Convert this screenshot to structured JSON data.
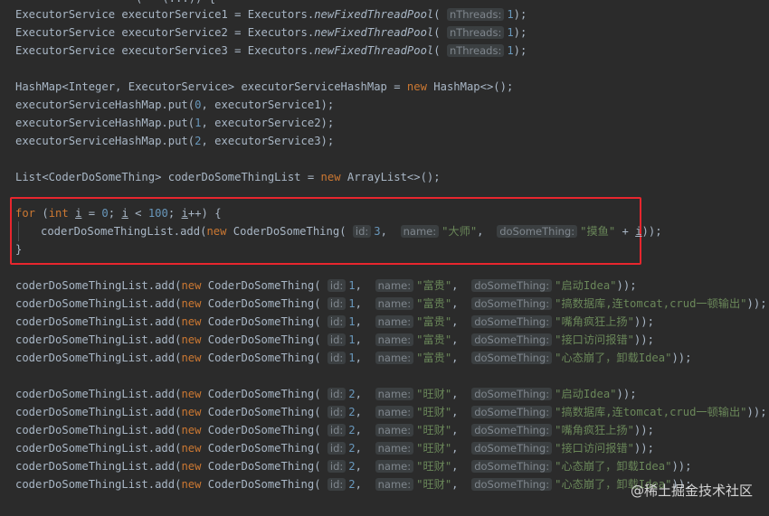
{
  "top_partial": "(   (...)) {",
  "executors": [
    {
      "var": "executorService1",
      "hint": "nThreads:",
      "val": "1"
    },
    {
      "var": "executorService2",
      "hint": "nThreads:",
      "val": "1"
    },
    {
      "var": "executorService3",
      "hint": "nThreads:",
      "val": "1"
    }
  ],
  "hashmap_decl": "HashMap<Integer, ExecutorService> executorServiceHashMap = ",
  "new_kw": "new",
  "hashmap_ctor": " HashMap<>();",
  "puts": [
    {
      "idx": "0",
      "var": "executorService1"
    },
    {
      "idx": "1",
      "var": "executorService2"
    },
    {
      "idx": "2",
      "var": "executorService3"
    }
  ],
  "list_decl": "List<CoderDoSomeThing> coderDoSomeThingList = ",
  "list_ctor": " ArrayList<>();",
  "for_loop": {
    "kw_for": "for",
    "kw_int": "int",
    "limit": "100",
    "body_id": "3",
    "body_name": "\"大师\"",
    "body_do": "\"摸鱼\"",
    "close": "}"
  },
  "hints": {
    "id": "id:",
    "name": "name:",
    "do": "doSomeThing:"
  },
  "adds": [
    {
      "id": "1",
      "name": "\"富贵\"",
      "do": "\"启动Idea\""
    },
    {
      "id": "1",
      "name": "\"富贵\"",
      "do": "\"搞数据库,连tomcat,crud一顿输出\""
    },
    {
      "id": "1",
      "name": "\"富贵\"",
      "do": "\"嘴角疯狂上扬\""
    },
    {
      "id": "1",
      "name": "\"富贵\"",
      "do": "\"接口访问报错\""
    },
    {
      "id": "1",
      "name": "\"富贵\"",
      "do": "\"心态崩了，卸载Idea\""
    },
    {
      "id": "2",
      "name": "\"旺财\"",
      "do": "\"启动Idea\""
    },
    {
      "id": "2",
      "name": "\"旺财\"",
      "do": "\"搞数据库,连tomcat,crud一顿输出\""
    },
    {
      "id": "2",
      "name": "\"旺财\"",
      "do": "\"嘴角疯狂上扬\""
    },
    {
      "id": "2",
      "name": "\"旺财\"",
      "do": "\"接口访问报错\""
    },
    {
      "id": "2",
      "name": "\"旺财\"",
      "do": "\"心态崩了，卸载Idea\""
    },
    {
      "id": "2",
      "name": "\"旺财\"",
      "do": "\"心态崩了，卸载Idea\""
    }
  ],
  "watermark": "@稀土掘金技术社区",
  "colors": {
    "keyword": "#cc7832",
    "number": "#6897bb",
    "string": "#6a8759",
    "highlight": "#e8262e",
    "background": "#2b2b2b"
  }
}
